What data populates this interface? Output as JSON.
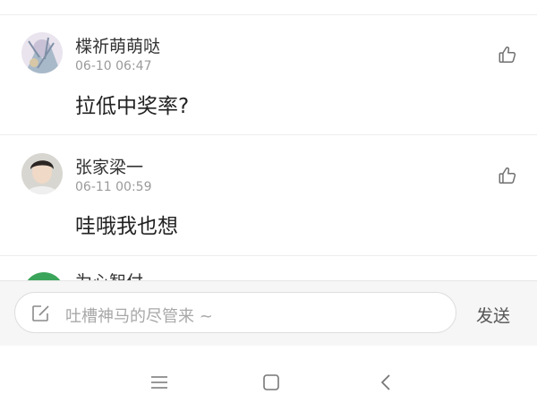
{
  "comments": [
    {
      "name": "楪祈萌萌哒",
      "time": "06-10 06:47",
      "text": "拉低中奖率?"
    },
    {
      "name": "张家梁一",
      "time": "06-11 00:59",
      "text": "哇哦我也想"
    },
    {
      "name": "为心智付"
    }
  ],
  "composer": {
    "placeholder": "吐槽神马的尽管来 ~",
    "send_label": "发送"
  },
  "nav": [
    "menu-icon",
    "home-icon",
    "back-icon"
  ]
}
